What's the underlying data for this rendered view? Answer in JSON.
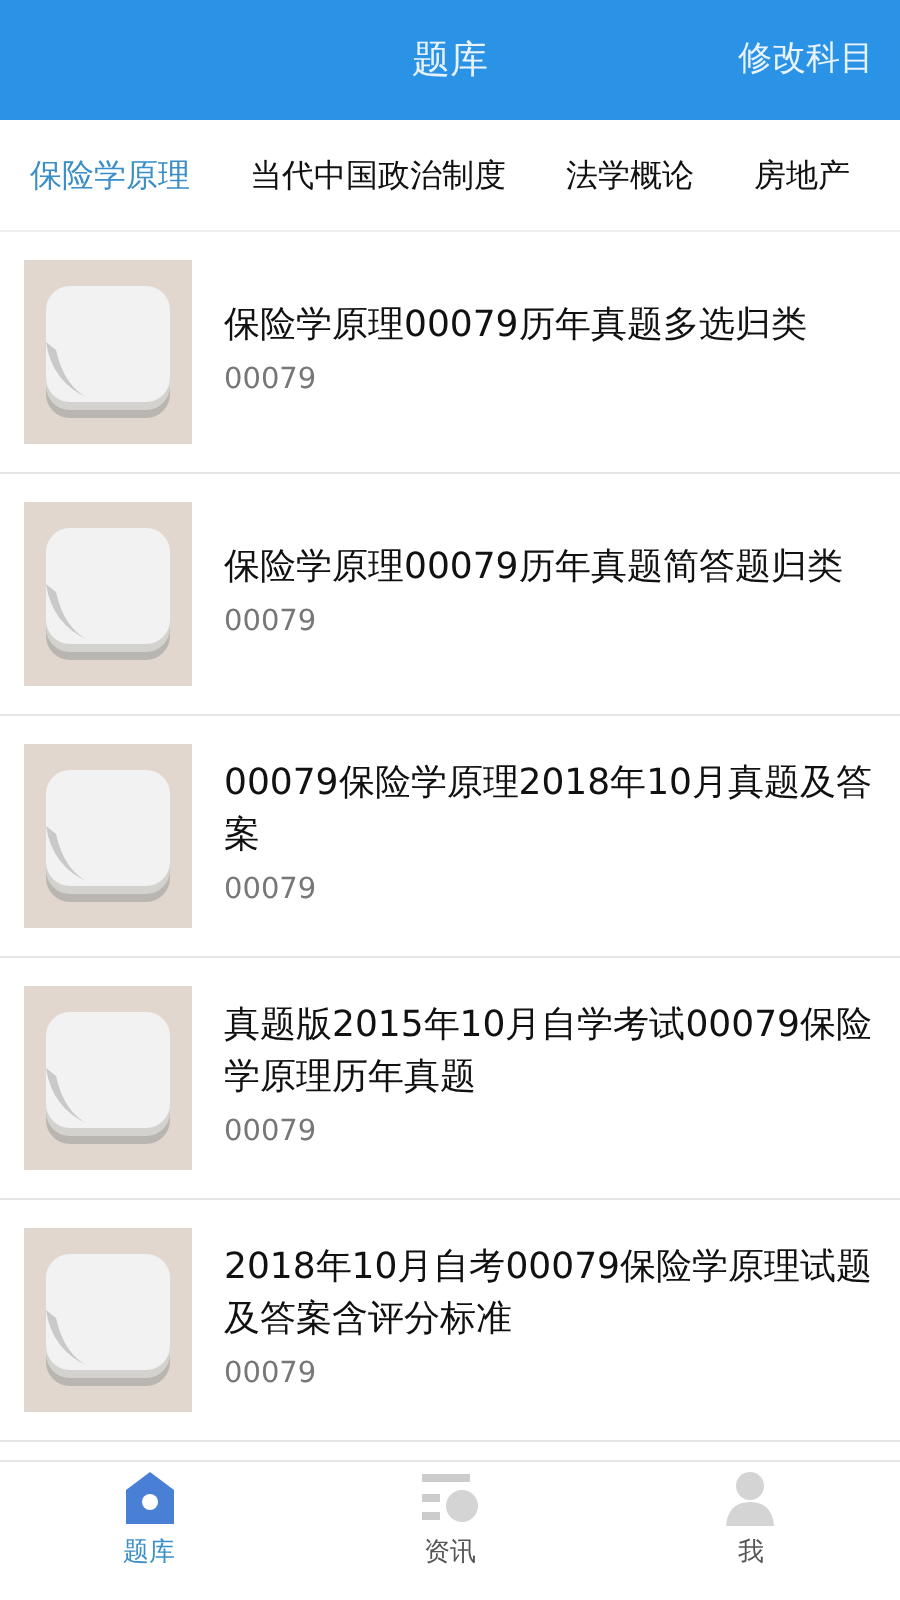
{
  "header": {
    "title": "题库",
    "action": "修改科目"
  },
  "subject_tabs": [
    {
      "label": "保险学原理",
      "selected": true
    },
    {
      "label": "当代中国政治制度",
      "selected": false
    },
    {
      "label": "法学概论",
      "selected": false
    },
    {
      "label": "房地产",
      "selected": false
    }
  ],
  "items": [
    {
      "title": "保险学原理00079历年真题多选归类",
      "code": "00079"
    },
    {
      "title": "保险学原理00079历年真题简答题归类",
      "code": "00079"
    },
    {
      "title": "00079保险学原理2018年10月真题及答案",
      "code": "00079"
    },
    {
      "title": "真题版2015年10月自学考试00079保险学原理历年真题",
      "code": "00079"
    },
    {
      "title": "2018年10月自考00079保险学原理试题及答案含评分标准",
      "code": "00079"
    }
  ],
  "bottom_nav": [
    {
      "label": "题库",
      "kind": "home",
      "selected": true
    },
    {
      "label": "资讯",
      "kind": "news",
      "selected": false
    },
    {
      "label": "我",
      "kind": "profile",
      "selected": false
    }
  ]
}
